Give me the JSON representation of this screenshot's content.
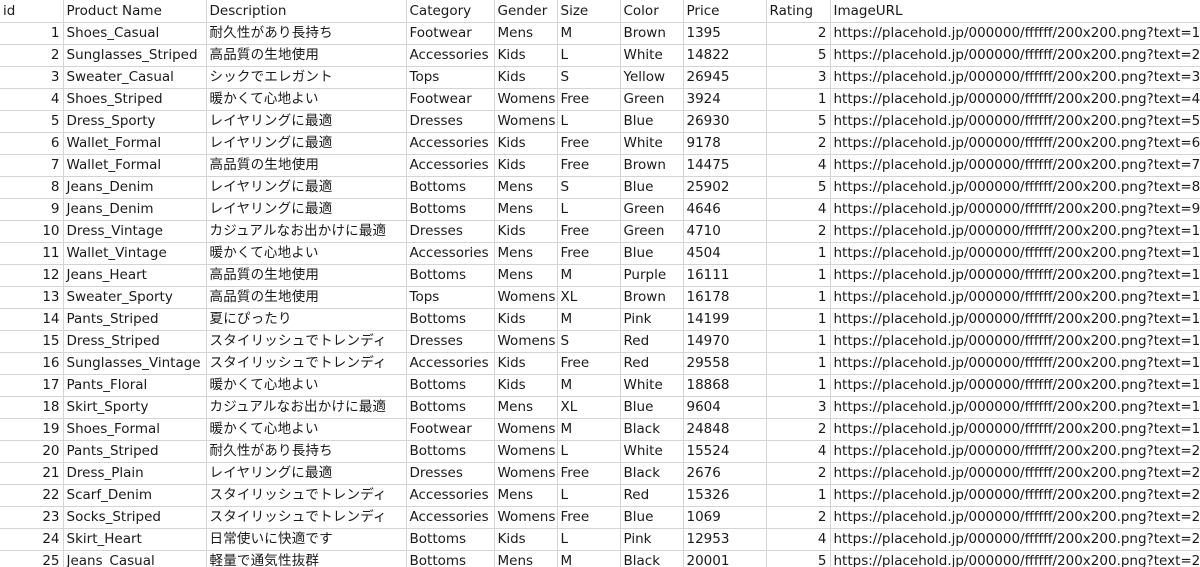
{
  "sheet": {
    "headers": [
      "id",
      "Product Name",
      "Description",
      "Category",
      "Gender",
      "Size",
      "Color",
      "Price",
      "Rating",
      "ImageURL"
    ],
    "rows": [
      [
        "1",
        "Shoes_Casual",
        "耐久性があり長持ち",
        "Footwear",
        "Mens",
        "M",
        "Brown",
        "1395",
        "2",
        "https://placehold.jp/000000/ffffff/200x200.png?text=1"
      ],
      [
        "2",
        "Sunglasses_Striped",
        "高品質の生地使用",
        "Accessories",
        "Kids",
        "L",
        "White",
        "14822",
        "5",
        "https://placehold.jp/000000/ffffff/200x200.png?text=2"
      ],
      [
        "3",
        "Sweater_Casual",
        "シックでエレガント",
        "Tops",
        "Kids",
        "S",
        "Yellow",
        "26945",
        "3",
        "https://placehold.jp/000000/ffffff/200x200.png?text=3"
      ],
      [
        "4",
        "Shoes_Striped",
        "暖かくて心地よい",
        "Footwear",
        "Womens",
        "Free",
        "Green",
        "3924",
        "1",
        "https://placehold.jp/000000/ffffff/200x200.png?text=4"
      ],
      [
        "5",
        "Dress_Sporty",
        "レイヤリングに最適",
        "Dresses",
        "Womens",
        "L",
        "Blue",
        "26930",
        "5",
        "https://placehold.jp/000000/ffffff/200x200.png?text=5"
      ],
      [
        "6",
        "Wallet_Formal",
        "レイヤリングに最適",
        "Accessories",
        "Kids",
        "Free",
        "White",
        "9178",
        "2",
        "https://placehold.jp/000000/ffffff/200x200.png?text=6"
      ],
      [
        "7",
        "Wallet_Formal",
        "高品質の生地使用",
        "Accessories",
        "Kids",
        "Free",
        "Brown",
        "14475",
        "4",
        "https://placehold.jp/000000/ffffff/200x200.png?text=7"
      ],
      [
        "8",
        "Jeans_Denim",
        "レイヤリングに最適",
        "Bottoms",
        "Mens",
        "S",
        "Blue",
        "25902",
        "5",
        "https://placehold.jp/000000/ffffff/200x200.png?text=8"
      ],
      [
        "9",
        "Jeans_Denim",
        "レイヤリングに最適",
        "Bottoms",
        "Mens",
        "L",
        "Green",
        "4646",
        "4",
        "https://placehold.jp/000000/ffffff/200x200.png?text=9"
      ],
      [
        "10",
        "Dress_Vintage",
        "カジュアルなお出かけに最適",
        "Dresses",
        "Kids",
        "Free",
        "Green",
        "4710",
        "2",
        "https://placehold.jp/000000/ffffff/200x200.png?text=10"
      ],
      [
        "11",
        "Wallet_Vintage",
        "暖かくて心地よい",
        "Accessories",
        "Mens",
        "Free",
        "Blue",
        "4504",
        "1",
        "https://placehold.jp/000000/ffffff/200x200.png?text=11"
      ],
      [
        "12",
        "Jeans_Heart",
        "高品質の生地使用",
        "Bottoms",
        "Mens",
        "M",
        "Purple",
        "16111",
        "1",
        "https://placehold.jp/000000/ffffff/200x200.png?text=12"
      ],
      [
        "13",
        "Sweater_Sporty",
        "高品質の生地使用",
        "Tops",
        "Womens",
        "XL",
        "Brown",
        "16178",
        "1",
        "https://placehold.jp/000000/ffffff/200x200.png?text=13"
      ],
      [
        "14",
        "Pants_Striped",
        "夏にぴったり",
        "Bottoms",
        "Kids",
        "M",
        "Pink",
        "14199",
        "1",
        "https://placehold.jp/000000/ffffff/200x200.png?text=14"
      ],
      [
        "15",
        "Dress_Striped",
        "スタイリッシュでトレンディ",
        "Dresses",
        "Womens",
        "S",
        "Red",
        "14970",
        "1",
        "https://placehold.jp/000000/ffffff/200x200.png?text=15"
      ],
      [
        "16",
        "Sunglasses_Vintage",
        "スタイリッシュでトレンディ",
        "Accessories",
        "Kids",
        "Free",
        "Red",
        "29558",
        "1",
        "https://placehold.jp/000000/ffffff/200x200.png?text=16"
      ],
      [
        "17",
        "Pants_Floral",
        "暖かくて心地よい",
        "Bottoms",
        "Kids",
        "M",
        "White",
        "18868",
        "1",
        "https://placehold.jp/000000/ffffff/200x200.png?text=17"
      ],
      [
        "18",
        "Skirt_Sporty",
        "カジュアルなお出かけに最適",
        "Bottoms",
        "Mens",
        "XL",
        "Blue",
        "9604",
        "3",
        "https://placehold.jp/000000/ffffff/200x200.png?text=18"
      ],
      [
        "19",
        "Shoes_Formal",
        "暖かくて心地よい",
        "Footwear",
        "Womens",
        "M",
        "Black",
        "24848",
        "2",
        "https://placehold.jp/000000/ffffff/200x200.png?text=19"
      ],
      [
        "20",
        "Pants_Striped",
        "耐久性があり長持ち",
        "Bottoms",
        "Womens",
        "L",
        "White",
        "15524",
        "4",
        "https://placehold.jp/000000/ffffff/200x200.png?text=20"
      ],
      [
        "21",
        "Dress_Plain",
        "レイヤリングに最適",
        "Dresses",
        "Womens",
        "Free",
        "Black",
        "2676",
        "2",
        "https://placehold.jp/000000/ffffff/200x200.png?text=21"
      ],
      [
        "22",
        "Scarf_Denim",
        "スタイリッシュでトレンディ",
        "Accessories",
        "Mens",
        "L",
        "Red",
        "15326",
        "1",
        "https://placehold.jp/000000/ffffff/200x200.png?text=22"
      ],
      [
        "23",
        "Socks_Striped",
        "スタイリッシュでトレンディ",
        "Accessories",
        "Womens",
        "Free",
        "Blue",
        "1069",
        "2",
        "https://placehold.jp/000000/ffffff/200x200.png?text=23"
      ],
      [
        "24",
        "Skirt_Heart",
        "日常使いに快適です",
        "Bottoms",
        "Kids",
        "L",
        "Pink",
        "12953",
        "4",
        "https://placehold.jp/000000/ffffff/200x200.png?text=24"
      ],
      [
        "25",
        "Jeans_Casual",
        "軽量で通気性抜群",
        "Bottoms",
        "Mens",
        "M",
        "Black",
        "20001",
        "5",
        "https://placehold.jp/000000/ffffff/200x200.png?text=25"
      ]
    ]
  },
  "colors": {
    "gridline": "#d4d4d4",
    "text": "#1a1a1a",
    "background": "#ffffff"
  }
}
